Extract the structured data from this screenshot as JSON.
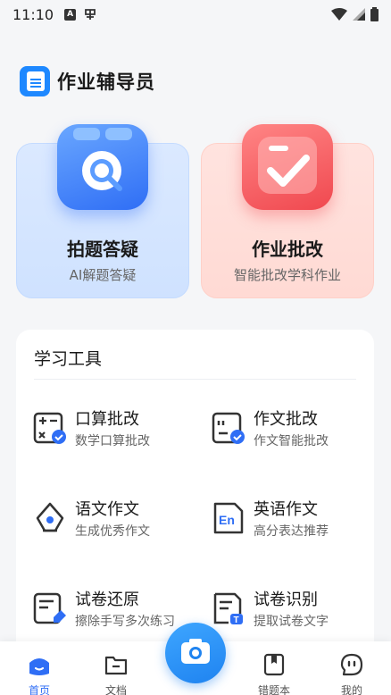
{
  "status_bar": {
    "time": "11:10"
  },
  "app": {
    "title": "作业辅导员"
  },
  "features": [
    {
      "title": "拍题答疑",
      "subtitle": "AI解题答疑"
    },
    {
      "title": "作业批改",
      "subtitle": "智能批改学科作业"
    }
  ],
  "tools": {
    "title": "学习工具",
    "items": [
      {
        "title": "口算批改",
        "subtitle": "数学口算批改",
        "icon": "calc-check-icon"
      },
      {
        "title": "作文批改",
        "subtitle": "作文智能批改",
        "icon": "essay-check-icon"
      },
      {
        "title": "语文作文",
        "subtitle": "生成优秀作文",
        "icon": "pen-nib-icon"
      },
      {
        "title": "英语作文",
        "subtitle": "高分表达推荐",
        "icon": "english-doc-icon"
      },
      {
        "title": "试卷还原",
        "subtitle": "擦除手写多次练习",
        "icon": "eraser-doc-icon"
      },
      {
        "title": "试卷识别",
        "subtitle": "提取试卷文字",
        "icon": "ocr-doc-icon"
      }
    ]
  },
  "nav": {
    "items": [
      {
        "label": "首页",
        "active": true
      },
      {
        "label": "文档",
        "active": false
      },
      {
        "label": "错题本",
        "active": false
      },
      {
        "label": "我的",
        "active": false
      }
    ]
  },
  "colors": {
    "accent": "#2f6ef5",
    "camera": "#1f83f0",
    "check_red": "#f0484f"
  }
}
